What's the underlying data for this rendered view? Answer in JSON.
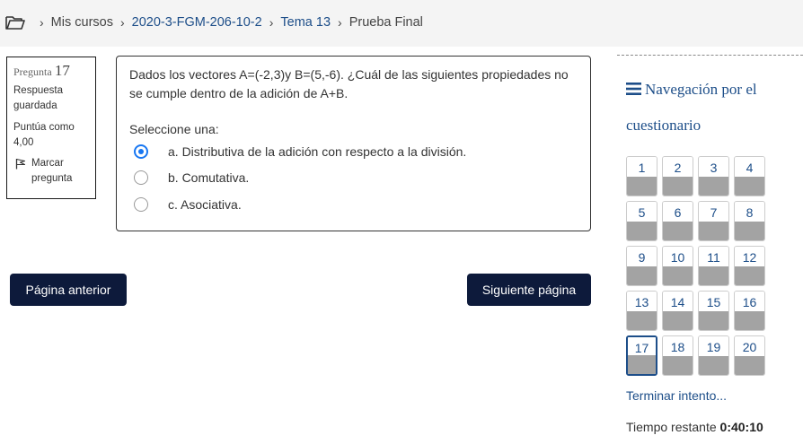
{
  "breadcrumb": {
    "items": [
      "Mis cursos",
      "2020-3-FGM-206-10-2",
      "Tema 13"
    ],
    "current": "Prueba Final"
  },
  "question_info": {
    "label": "Pregunta",
    "number": "17",
    "state": "Respuesta guardada",
    "grade": "Puntúa como 4,00",
    "flag_label": "Marcar pregunta"
  },
  "question": {
    "text_parts": [
      "Dados los vectores ",
      "A",
      "=(-2,3)y ",
      "B",
      "=(5,-6). ¿Cuál de las siguientes propiedades no se cumple dentro de la adición de A+B."
    ],
    "prompt": "Seleccione una:",
    "answers": [
      {
        "label": "a. Distributiva de la adición con respecto a la división.",
        "selected": true
      },
      {
        "label": "b. Comutativa.",
        "selected": false
      },
      {
        "label": "c. Asociativa.",
        "selected": false
      }
    ]
  },
  "buttons": {
    "prev": "Página anterior",
    "next": "Siguiente página"
  },
  "nav": {
    "title": "Navegación por el cuestionario",
    "questions": [
      "1",
      "2",
      "3",
      "4",
      "5",
      "6",
      "7",
      "8",
      "9",
      "10",
      "11",
      "12",
      "13",
      "14",
      "15",
      "16",
      "17",
      "18",
      "19",
      "20"
    ],
    "current": "17",
    "finish_link": "Terminar intento...",
    "time_label": "Tiempo restante",
    "time_value": "0:40:10"
  },
  "colors": {
    "accent": "#1d4e89",
    "button_bg": "#0d1a3b",
    "radio_checked": "#1877f2",
    "answered_fill": "#a3a3a3"
  }
}
